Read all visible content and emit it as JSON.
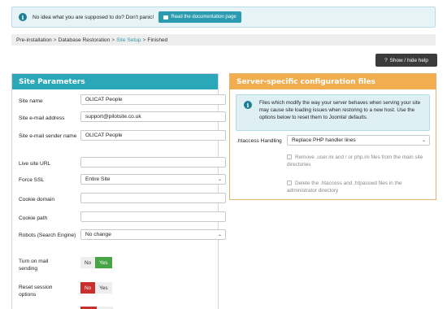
{
  "info": {
    "message": "No idea what you are supposed to do? Don't panic!",
    "doc_button": "Read the documentation page"
  },
  "breadcrumb": [
    {
      "label": "Pre-installation",
      "active": false
    },
    {
      "label": "Database Restoration",
      "active": false
    },
    {
      "label": "Site Setup",
      "active": true
    },
    {
      "label": "Finished",
      "active": false
    }
  ],
  "toolbar": {
    "toggle_help": "Show / hide help"
  },
  "site_params": {
    "title": "Site Parameters",
    "site_name": {
      "label": "Site name",
      "value": "OLICAT People"
    },
    "site_email": {
      "label": "Site e-mail address",
      "value": "support@pilotsite.co.uk"
    },
    "sender_name": {
      "label": "Site e-mail sender name",
      "value": "OLICAT People"
    },
    "live_url": {
      "label": "Live site URL",
      "value": ""
    },
    "force_ssl": {
      "label": "Force SSL",
      "value": "Entire Site"
    },
    "cookie_domain": {
      "label": "Cookie domain",
      "value": ""
    },
    "cookie_path": {
      "label": "Cookie path",
      "value": ""
    },
    "robots": {
      "label": "Robots (Search Engine)",
      "value": "No change"
    },
    "mail_sending": {
      "label": "Turn on mail sending",
      "no": "No",
      "yes": "Yes",
      "selected": "Yes"
    },
    "reset_session": {
      "label": "Reset session options",
      "no": "No",
      "yes": "Yes",
      "selected": "No"
    }
  },
  "server_config": {
    "title": "Server-specific configuration files",
    "alert": "Files which modify the way your server behaves when serving your site may cause site loading issues when restoring to a new host. Use the options below to reset them to Joomla! defaults.",
    "htaccess": {
      "label": ".htaccess Handling",
      "value": "Replace PHP handler lines"
    },
    "remove_ini": "Remove .user.ini and / or php.ini files from the main site directories",
    "delete_htaccess": "Delete the .htaccess and .htpasswd files in the administrator directory"
  },
  "colors": {
    "accent": "#2aa7b8",
    "orange": "#f2ad4e",
    "green": "#46a546",
    "red": "#c9302c"
  }
}
